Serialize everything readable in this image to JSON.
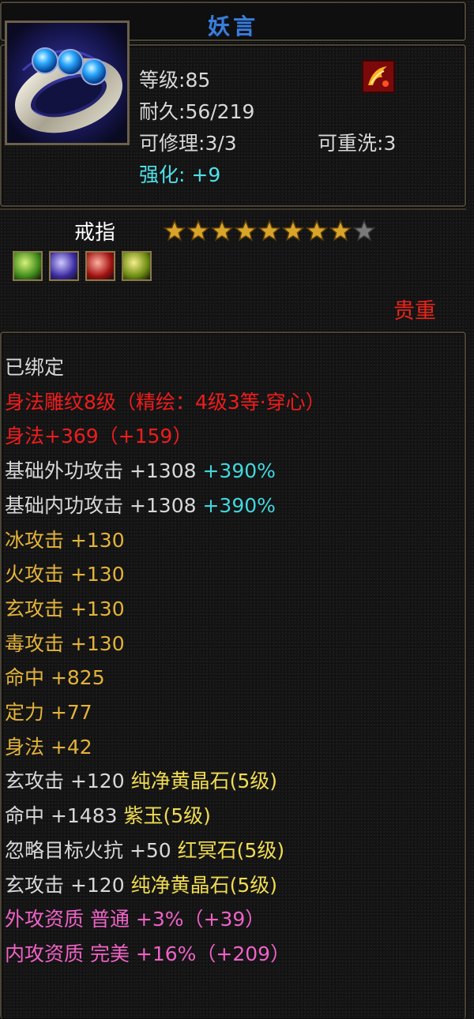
{
  "title": "妖言",
  "item": {
    "level_label": "等级:",
    "level": "85",
    "durability_label": "耐久:",
    "durability": "56/219",
    "repairable_label": "可修理:",
    "repairable": "3/3",
    "rewash_label": "可重洗:",
    "rewash": "3",
    "enhance_label": "强化:",
    "enhance": " +9",
    "type": "戒指",
    "stars": {
      "filled": 8,
      "total": 9
    },
    "gem_icons": [
      "green-gem-icon",
      "purple-gem-icon",
      "red-gem-icon",
      "yellow-gem-icon"
    ],
    "rarity": "贵重"
  },
  "colors": {
    "title": "#3a7ed8",
    "cyan": "#42d7de",
    "red": "#f01c1c",
    "yellow": "#ecc23c",
    "pink": "#ef62c6",
    "white": "#d8d8d8"
  },
  "attributes": [
    {
      "parts": [
        {
          "text": "已绑定",
          "color": "white"
        }
      ]
    },
    {
      "parts": [
        {
          "text": "身法雕纹8级（精绘：4级3等·穿心）",
          "color": "red"
        }
      ]
    },
    {
      "parts": [
        {
          "text": "身法+369（+159）",
          "color": "red"
        }
      ]
    },
    {
      "parts": [
        {
          "text": "基础外功攻击 +1308 ",
          "color": "white"
        },
        {
          "text": "+390%",
          "color": "cyan"
        }
      ]
    },
    {
      "parts": [
        {
          "text": "基础内功攻击 +1308 ",
          "color": "white"
        },
        {
          "text": "+390%",
          "color": "cyan"
        }
      ]
    },
    {
      "parts": [
        {
          "text": "冰攻击 +130",
          "color": "gold"
        }
      ]
    },
    {
      "parts": [
        {
          "text": "火攻击 +130",
          "color": "gold"
        }
      ]
    },
    {
      "parts": [
        {
          "text": "玄攻击 +130",
          "color": "gold"
        }
      ]
    },
    {
      "parts": [
        {
          "text": "毒攻击 +130",
          "color": "gold"
        }
      ]
    },
    {
      "parts": [
        {
          "text": "命中 +825",
          "color": "gold"
        }
      ]
    },
    {
      "parts": [
        {
          "text": "定力 +77",
          "color": "gold"
        }
      ]
    },
    {
      "parts": [
        {
          "text": "身法 +42",
          "color": "gold"
        }
      ]
    },
    {
      "parts": [
        {
          "text": "玄攻击 +120 ",
          "color": "white"
        },
        {
          "text": "纯净黄晶石(5级)",
          "color": "yellow2"
        }
      ]
    },
    {
      "parts": [
        {
          "text": "命中 +1483 ",
          "color": "white"
        },
        {
          "text": "紫玉(5级)",
          "color": "yellow2"
        }
      ]
    },
    {
      "parts": [
        {
          "text": "忽略目标火抗 +50 ",
          "color": "white"
        },
        {
          "text": "红冥石(5级)",
          "color": "yellow2"
        }
      ]
    },
    {
      "parts": [
        {
          "text": "玄攻击 +120 ",
          "color": "white"
        },
        {
          "text": "纯净黄晶石(5级)",
          "color": "yellow2"
        }
      ]
    },
    {
      "parts": [
        {
          "text": "外攻资质  普通 +3%（+39）",
          "color": "pink"
        }
      ]
    },
    {
      "parts": [
        {
          "text": "内攻资质  完美 +16%（+209）",
          "color": "pink"
        }
      ]
    }
  ]
}
